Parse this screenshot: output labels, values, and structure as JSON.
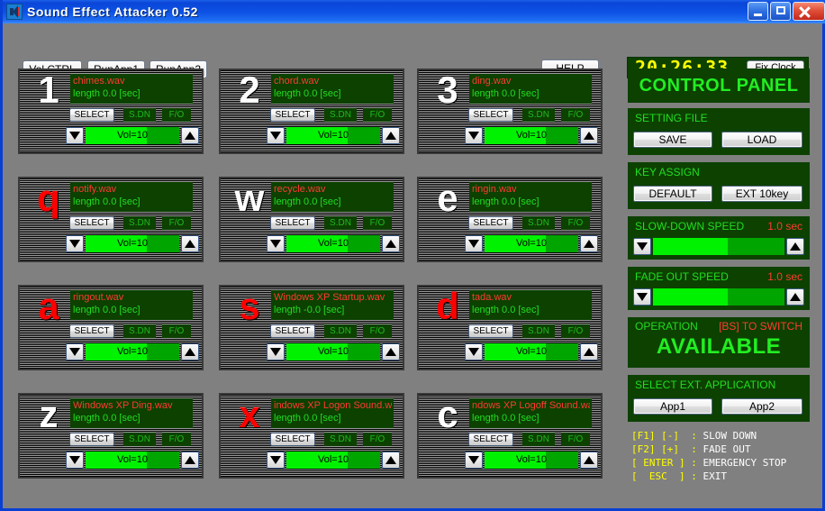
{
  "window": {
    "title": "Sound Effect Attacker 0.52",
    "icon": "speaker-icon",
    "buttons": {
      "minimize": "minimize-icon",
      "maximize": "maximize-icon",
      "close": "close-icon"
    },
    "colors": {
      "titlebar": "#0a46d8",
      "background": "#808080",
      "panel_bg": "#0c4100",
      "green_text": "#22dd22",
      "red_text": "#ff3b30",
      "yellow_text": "#ffff00",
      "bright_green": "#00f200"
    }
  },
  "toolbar": {
    "volctrl_label": "Vol.CTRL",
    "runapp1_label": "RunApp1",
    "runapp2_label": "RunApp2",
    "help_label": "HELP",
    "clock_time": "20:26:33",
    "fix_clock_label": "Fix Clock"
  },
  "cells": [
    {
      "key": "1",
      "key_color": "white",
      "file": "chimes.wav",
      "length": "length 0.0 [sec]",
      "select_label": "SELECT",
      "sdn_label": "S.DN",
      "fo_label": "F/O",
      "vol_label": "Vol=10",
      "vol_percent": 65
    },
    {
      "key": "2",
      "key_color": "white",
      "file": "chord.wav",
      "length": "length 0.0 [sec]",
      "select_label": "SELECT",
      "sdn_label": "S.DN",
      "fo_label": "F/O",
      "vol_label": "Vol=10",
      "vol_percent": 65
    },
    {
      "key": "3",
      "key_color": "white",
      "file": "ding.wav",
      "length": "length 0.0 [sec]",
      "select_label": "SELECT",
      "sdn_label": "S.DN",
      "fo_label": "F/O",
      "vol_label": "Vol=10",
      "vol_percent": 65
    },
    {
      "key": "q",
      "key_color": "red",
      "file": "notify.wav",
      "length": "length 0.0 [sec]",
      "select_label": "SELECT",
      "sdn_label": "S.DN",
      "fo_label": "F/O",
      "vol_label": "Vol=10",
      "vol_percent": 65
    },
    {
      "key": "w",
      "key_color": "white",
      "file": "recycle.wav",
      "length": "length 0.0 [sec]",
      "select_label": "SELECT",
      "sdn_label": "S.DN",
      "fo_label": "F/O",
      "vol_label": "Vol=10",
      "vol_percent": 65
    },
    {
      "key": "e",
      "key_color": "white",
      "file": "ringin.wav",
      "length": "length 0.0 [sec]",
      "select_label": "SELECT",
      "sdn_label": "S.DN",
      "fo_label": "F/O",
      "vol_label": "Vol=10",
      "vol_percent": 65
    },
    {
      "key": "a",
      "key_color": "red",
      "file": "ringout.wav",
      "length": "length 0.0 [sec]",
      "select_label": "SELECT",
      "sdn_label": "S.DN",
      "fo_label": "F/O",
      "vol_label": "Vol=10",
      "vol_percent": 65
    },
    {
      "key": "s",
      "key_color": "red",
      "file": "Windows XP Startup.wav",
      "length": "length -0.0 [sec]",
      "select_label": "SELECT",
      "sdn_label": "S.DN",
      "fo_label": "F/O",
      "vol_label": "Vol=10",
      "vol_percent": 65
    },
    {
      "key": "d",
      "key_color": "red",
      "file": "tada.wav",
      "length": "length 0.0 [sec]",
      "select_label": "SELECT",
      "sdn_label": "S.DN",
      "fo_label": "F/O",
      "vol_label": "Vol=10",
      "vol_percent": 65
    },
    {
      "key": "z",
      "key_color": "white",
      "file": "Windows XP Ding.wav",
      "length": "length 0.0 [sec]",
      "select_label": "SELECT",
      "sdn_label": "S.DN",
      "fo_label": "F/O",
      "vol_label": "Vol=10",
      "vol_percent": 65
    },
    {
      "key": "x",
      "key_color": "red",
      "file": "indows XP Logon Sound.wav",
      "length": "length 0.0 [sec]",
      "select_label": "SELECT",
      "sdn_label": "S.DN",
      "fo_label": "F/O",
      "vol_label": "Vol=10",
      "vol_percent": 65
    },
    {
      "key": "c",
      "key_color": "white",
      "file": "ndows XP Logoff Sound.wav",
      "length": "length 0.0 [sec]",
      "select_label": "SELECT",
      "sdn_label": "S.DN",
      "fo_label": "F/O",
      "vol_label": "Vol=10",
      "vol_percent": 65
    }
  ],
  "panel": {
    "title": "CONTROL PANEL",
    "setting_file": {
      "label": "SETTING FILE",
      "save_label": "SAVE",
      "load_label": "LOAD"
    },
    "key_assign": {
      "label": "KEY ASSIGN",
      "default_label": "DEFAULT",
      "ext10key_label": "EXT 10key"
    },
    "slow_down": {
      "label": "SLOW-DOWN SPEED",
      "value": "1.0 sec",
      "percent": 57
    },
    "fade_out": {
      "label": "FADE OUT SPEED",
      "value": "1.0 sec",
      "percent": 57
    },
    "operation": {
      "label": "OPERATION",
      "hint": "[BS] TO SWITCH",
      "status": "AVAILABLE"
    },
    "ext_application": {
      "label": "SELECT EXT. APPLICATION",
      "app1_label": "App1",
      "app2_label": "App2"
    },
    "legend": [
      {
        "key": "[F1] [-]  ",
        "sep": ": ",
        "action": "SLOW DOWN"
      },
      {
        "key": "[F2] [+]  ",
        "sep": ": ",
        "action": "FADE OUT"
      },
      {
        "key": "[ ENTER ] ",
        "sep": ": ",
        "action": "EMERGENCY STOP"
      },
      {
        "key": "[  ESC  ] ",
        "sep": ": ",
        "action": "EXIT"
      }
    ]
  }
}
